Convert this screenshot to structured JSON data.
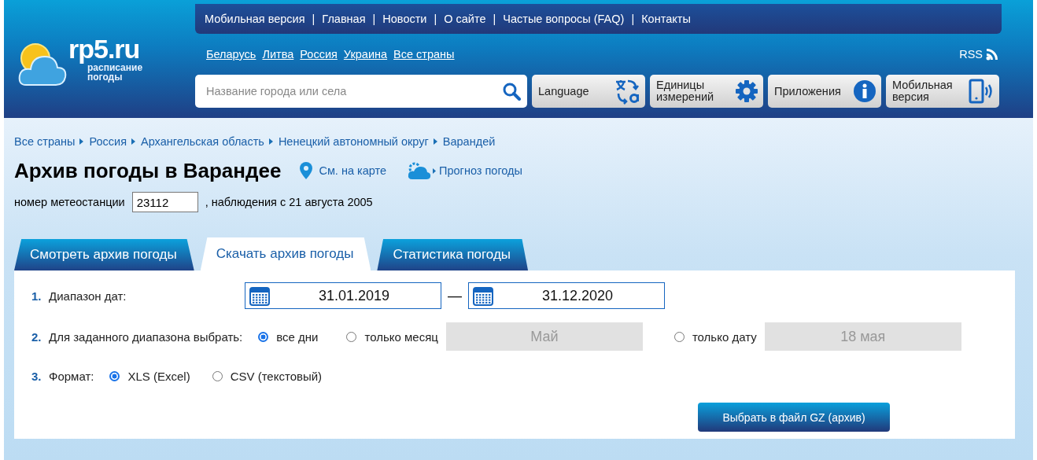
{
  "logo": {
    "name": "rp5.ru",
    "tagline_1": "расписание",
    "tagline_2": "погоды"
  },
  "top_menu": {
    "separator": "|",
    "items": [
      "Мобильная версия",
      "Главная",
      "Новости",
      "О сайте",
      "Частые вопросы (FAQ)",
      "Контакты"
    ]
  },
  "countries": [
    "Беларусь",
    "Литва",
    "Россия",
    "Украина",
    "Все страны"
  ],
  "rss": "RSS",
  "search": {
    "placeholder": "Название города или села"
  },
  "tool_buttons": [
    {
      "kind": "language",
      "label": "Language"
    },
    {
      "kind": "units",
      "label": "Единицы измерений"
    },
    {
      "kind": "apps",
      "label": "Приложения"
    },
    {
      "kind": "mobile",
      "label": "Мобильная версия"
    }
  ],
  "breadcrumb": [
    "Все страны",
    "Россия",
    "Архангельская область",
    "Ненецкий автономный округ",
    "Варандей"
  ],
  "title": "Архив погоды в Варандее",
  "map_link": "См. на карте",
  "forecast_link": "Прогноз погоды",
  "station": {
    "label": "номер метеостанции",
    "value": "23112",
    "since": ", наблюдения с 21 августа 2005"
  },
  "tabs": [
    {
      "label": "Смотреть архив погоды",
      "selected": false
    },
    {
      "label": "Скачать архив погоды",
      "selected": true
    },
    {
      "label": "Статистика погоды",
      "selected": false
    }
  ],
  "form": {
    "date_range": {
      "number": "1.",
      "label": "Диапазон дат:",
      "from": "31.01.2019",
      "dash": "—",
      "to": "31.12.2020"
    },
    "period": {
      "number": "2.",
      "label": "Для заданного диапазона выбрать:",
      "options": [
        {
          "label": "все дни",
          "selected": true
        },
        {
          "label": "только месяц",
          "selected": false,
          "field": "Май",
          "disabled": true
        },
        {
          "label": "только дату",
          "selected": false,
          "field": "18 мая",
          "disabled": true
        }
      ]
    },
    "format": {
      "number": "3.",
      "label": "Формат:",
      "options": [
        {
          "label": "XLS (Excel)",
          "selected": true
        },
        {
          "label": "CSV (текстовый)",
          "selected": false
        }
      ]
    },
    "submit": "Выбрать в файл GZ (архив)"
  }
}
